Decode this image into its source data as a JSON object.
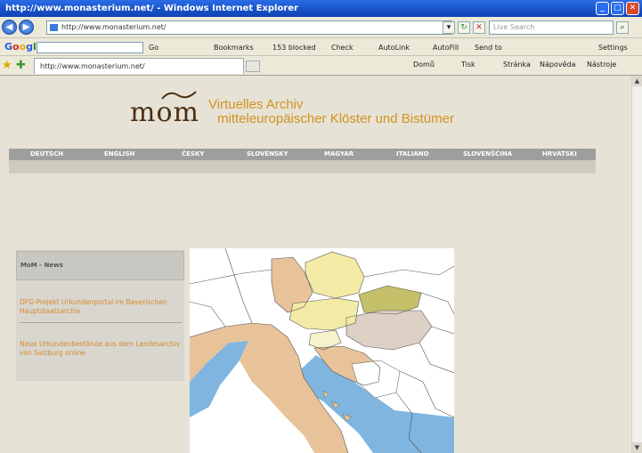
{
  "browser": {
    "title": "http://www.monasterium.net/ - Windows Internet Explorer",
    "address": "http://www.monasterium.net/",
    "search_placeholder": "Live Search",
    "window_buttons": [
      "_",
      "□",
      "✕"
    ]
  },
  "google_bar": {
    "logo": {
      "g": "G",
      "o1": "o",
      "o2": "o",
      "g2": "g",
      "l": "l",
      "e": "e"
    },
    "go_label": "Go",
    "items": [
      "Bookmarks",
      "153 blocked",
      "Check",
      "AutoLink",
      "AutoFill",
      "Send to",
      "Settings"
    ]
  },
  "fav_bar": {
    "tab_title": "http://www.monasterium.net/",
    "commands": [
      "Domů",
      "Tisk",
      "Stránka",
      "Nástroje"
    ],
    "help": "Nápověda"
  },
  "page": {
    "logo_word": "mom",
    "logo_line1": "Virtuelles Archiv",
    "logo_line2": "mitteleuropäischer Klöster und Bistümer",
    "languages": [
      "Deutsch",
      "English",
      "Česky",
      "Slovensky",
      "Magyar",
      "Italiano",
      "Slovenščina",
      "Hrvatski"
    ],
    "sidebar": {
      "heading": "MoM - News",
      "news": [
        "DFG-Projekt Urkundenportal im Bayerischen Hauptstaatsarchiv",
        "Neue Urkundenbestände aus dem Landesarchiv von Salzburg online"
      ]
    }
  },
  "colors": {
    "titlebar": "#1953c7",
    "logo_accent": "#d2931d",
    "langbar": "#9e9e9e",
    "map_sea": "#7fb5df",
    "map_orange": "#e8c39a",
    "map_yellow": "#f3eaa6",
    "map_olive": "#c4c06a",
    "map_hungary": "#ddd0c4"
  }
}
